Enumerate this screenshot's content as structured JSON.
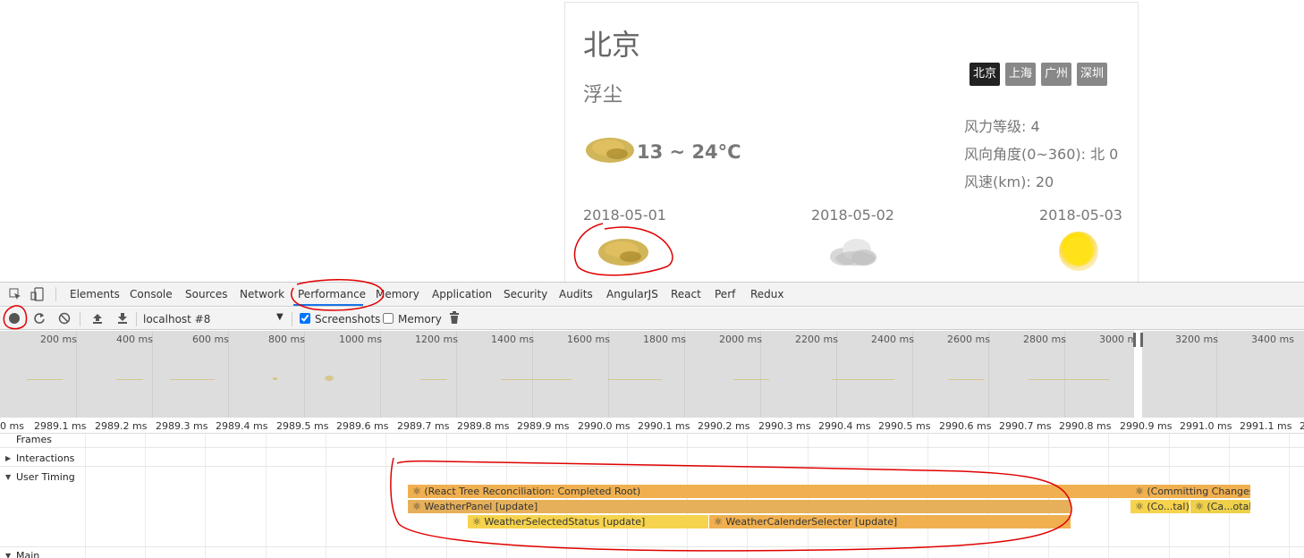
{
  "weather": {
    "city": "北京",
    "description": "浮尘",
    "temperature": "13 ~ 24°C",
    "city_buttons": [
      "北京",
      "上海",
      "广州",
      "深圳"
    ],
    "active_city": "北京",
    "wind_level": "风力等级: 4",
    "wind_direction": "风向角度(0~360): 北 0",
    "wind_speed": "风速(km): 20",
    "forecast": [
      {
        "date": "2018-05-01",
        "icon": "dust-icon"
      },
      {
        "date": "2018-05-02",
        "icon": "cloud-icon"
      },
      {
        "date": "2018-05-03",
        "icon": "sun-icon"
      }
    ]
  },
  "devtools": {
    "tabs": [
      "Elements",
      "Console",
      "Sources",
      "Network",
      "Performance",
      "Memory",
      "Application",
      "Security",
      "Audits",
      "AngularJS",
      "React",
      "Perf",
      "Redux"
    ],
    "active_tab": "Performance",
    "profile_select": "localhost #8",
    "screenshots_label": "Screenshots",
    "screenshots_checked": true,
    "memory_label": "Memory",
    "memory_checked": false,
    "overview_ticks": [
      "200 ms",
      "400 ms",
      "600 ms",
      "800 ms",
      "1000 ms",
      "1200 ms",
      "1400 ms",
      "1600 ms",
      "1800 ms",
      "2000 ms",
      "2200 ms",
      "2400 ms",
      "2600 ms",
      "2800 ms",
      "3000 ms",
      "3200 ms",
      "3400 ms"
    ],
    "ruler_ticks": [
      "0 ms",
      "2989.1 ms",
      "2989.2 ms",
      "2989.3 ms",
      "2989.4 ms",
      "2989.5 ms",
      "2989.6 ms",
      "2989.7 ms",
      "2989.8 ms",
      "2989.9 ms",
      "2990.0 ms",
      "2990.1 ms",
      "2990.2 ms",
      "2990.3 ms",
      "2990.4 ms",
      "2990.5 ms",
      "2990.6 ms",
      "2990.7 ms",
      "2990.8 ms",
      "2990.9 ms",
      "2991.0 ms",
      "2991.1 ms",
      "2"
    ],
    "tracks": {
      "frames": "Frames",
      "interactions": "Interactions",
      "user_timing": "User Timing",
      "main": "Main"
    },
    "bars": {
      "reconciliation": "⚛ (React Tree Reconciliation: Completed Root)",
      "weather_panel": "⚛ WeatherPanel [update]",
      "selected_status": "⚛ WeatherSelectedStatus [update]",
      "calender_selecter": "⚛ WeatherCalenderSelecter [update]",
      "committing": "⚛ (Committing Changes)",
      "co_tal": "⚛ (Co...tal)",
      "ca_otal": "⚛ (Ca...otal)"
    },
    "colors": {
      "bar_orange": "#f0b050",
      "bar_yellow": "#f6d34d",
      "annotation_red": "#e00000",
      "tab_underline": "#1a73e8"
    }
  }
}
